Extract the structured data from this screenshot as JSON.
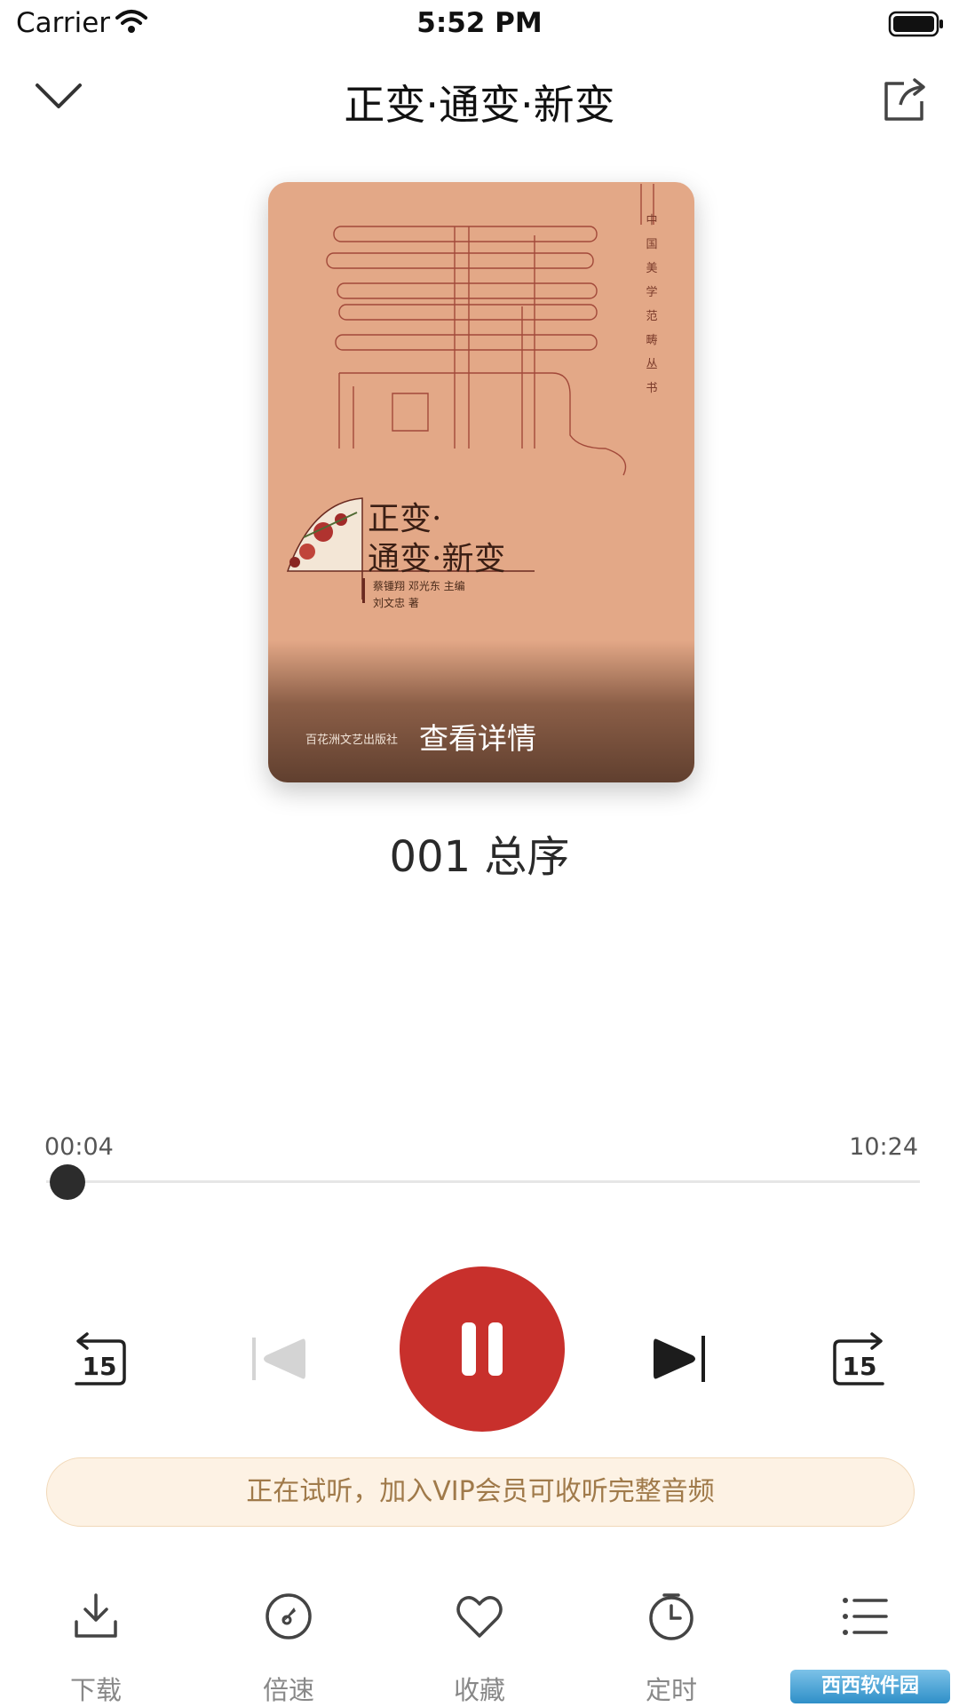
{
  "status_bar": {
    "carrier": "Carrier",
    "time": "5:52 PM"
  },
  "nav": {
    "title": "正变·通变·新变"
  },
  "cover": {
    "series_vertical": "中国美学范畴丛书",
    "title_line1": "正变·",
    "title_line2": "通变·新变",
    "editors": "蔡锺翔 邓光东 主编",
    "author": "刘文忠 著",
    "publisher": "百花洲文艺出版社",
    "detail_label": "查看详情"
  },
  "track": {
    "title": "001 总序"
  },
  "progress": {
    "current": "00:04",
    "total": "10:24",
    "fraction": 0.006
  },
  "controls": {
    "rewind_seconds": "15",
    "forward_seconds": "15",
    "state": "playing"
  },
  "trial_banner": "正在试听，加入VIP会员可收听完整音频",
  "toolbar": {
    "download": "下载",
    "speed": "倍速",
    "favorite": "收藏",
    "timer": "定时",
    "catalog": "目录"
  },
  "watermark": "西西软件园",
  "colors": {
    "accent": "#c8302c",
    "banner_bg": "#fdf2e4",
    "banner_text": "#a07a4a",
    "cover_bg": "#e3a887"
  }
}
